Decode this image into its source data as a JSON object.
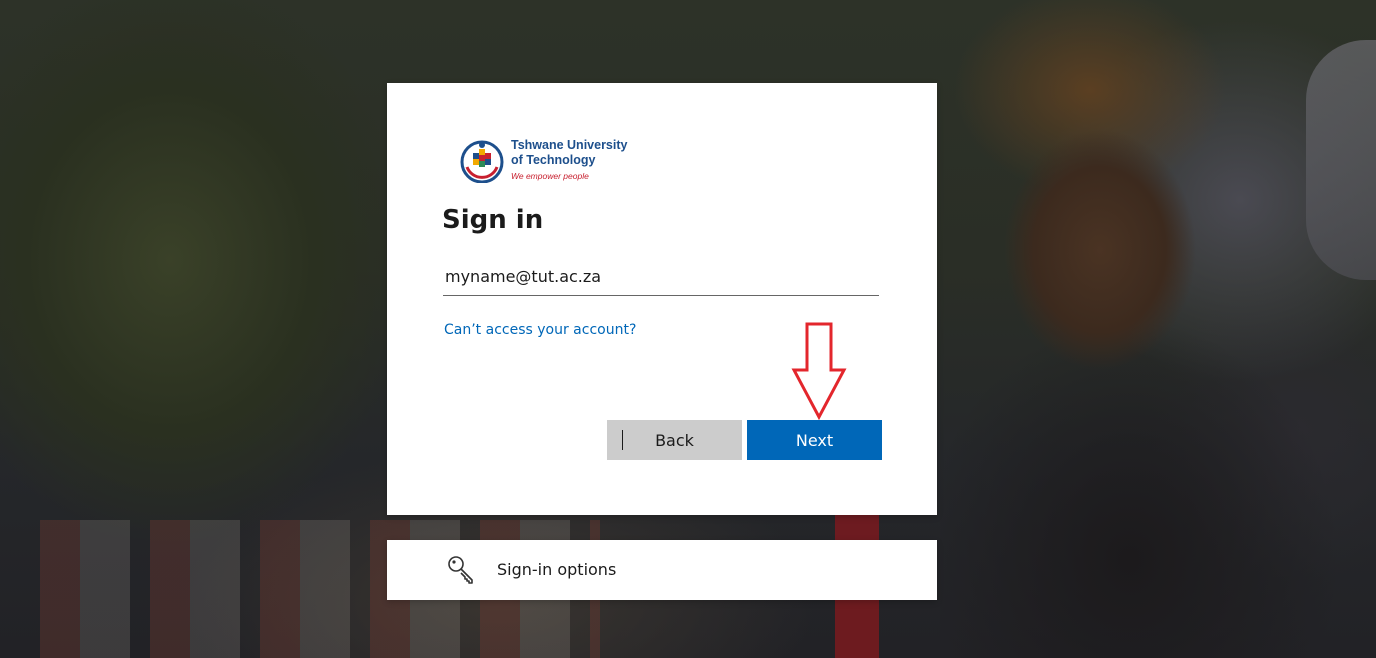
{
  "logo": {
    "line1": "Tshwane University",
    "line2": "of Technology",
    "tagline": "We empower people"
  },
  "signin": {
    "title": "Sign in",
    "email_value": "myname@tut.ac.za",
    "cant_access_link": "Can’t access your account?",
    "back_label": "Back",
    "next_label": "Next"
  },
  "sign_in_options": {
    "label": "Sign-in options",
    "icon": "key-icon"
  },
  "annotation": {
    "icon": "arrow-down-icon",
    "color": "#e3262c"
  },
  "colors": {
    "primary": "#0067b8",
    "back_button": "#cccccc",
    "brand_blue": "#1d4f8c",
    "brand_red": "#c8202f"
  }
}
